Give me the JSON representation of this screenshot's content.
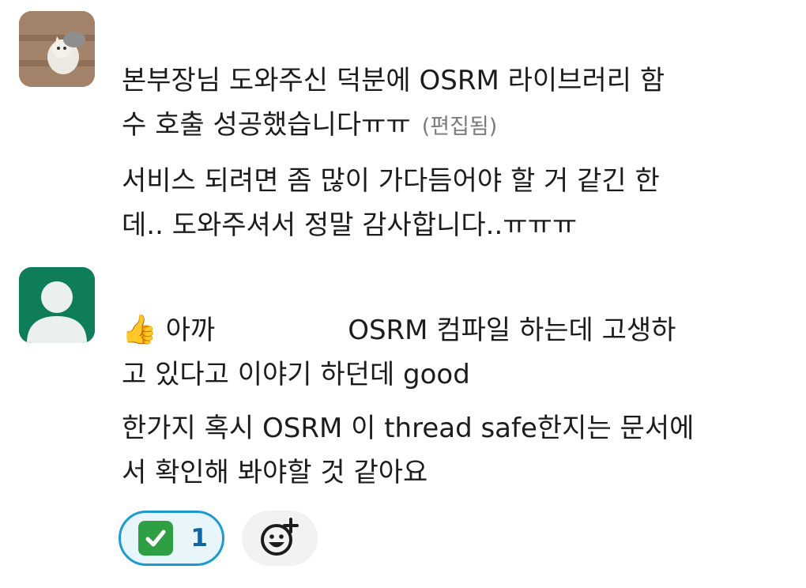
{
  "messages": [
    {
      "avatar": "cat-photo-avatar",
      "lines": [
        "본부장님 도와주신 덕분에 OSRM 라이브러리 함",
        "수 호출 성공했습니다ㅠㅠ"
      ],
      "edited_label": "(편집됨)",
      "second_paragraph": [
        "서비스 되려면 좀 많이 가다듬어야 할 거 같긴 한",
        "데.. 도와주셔서 정말 감사합니다..ㅠㅠㅠ"
      ]
    },
    {
      "avatar": "default-user-avatar",
      "lines_part1_prefix": "아까",
      "lines_part1_suffix": "OSRM 컴파일 하는데 고생하",
      "lines_part2": "고 있다고 이야기 하던데 good",
      "second_paragraph": [
        "한가지 혹시 OSRM 이 thread safe한지는 문서에",
        "서 확인해 봐야할 것 같아요"
      ]
    }
  ],
  "reactions": [
    {
      "emoji": "white-check-mark-icon",
      "count": "1"
    }
  ],
  "colors": {
    "reaction_border": "#1d9bd1",
    "reaction_bg": "#e8f5fa",
    "count": "#1264a3",
    "avatar_green": "#0f7d5a"
  }
}
